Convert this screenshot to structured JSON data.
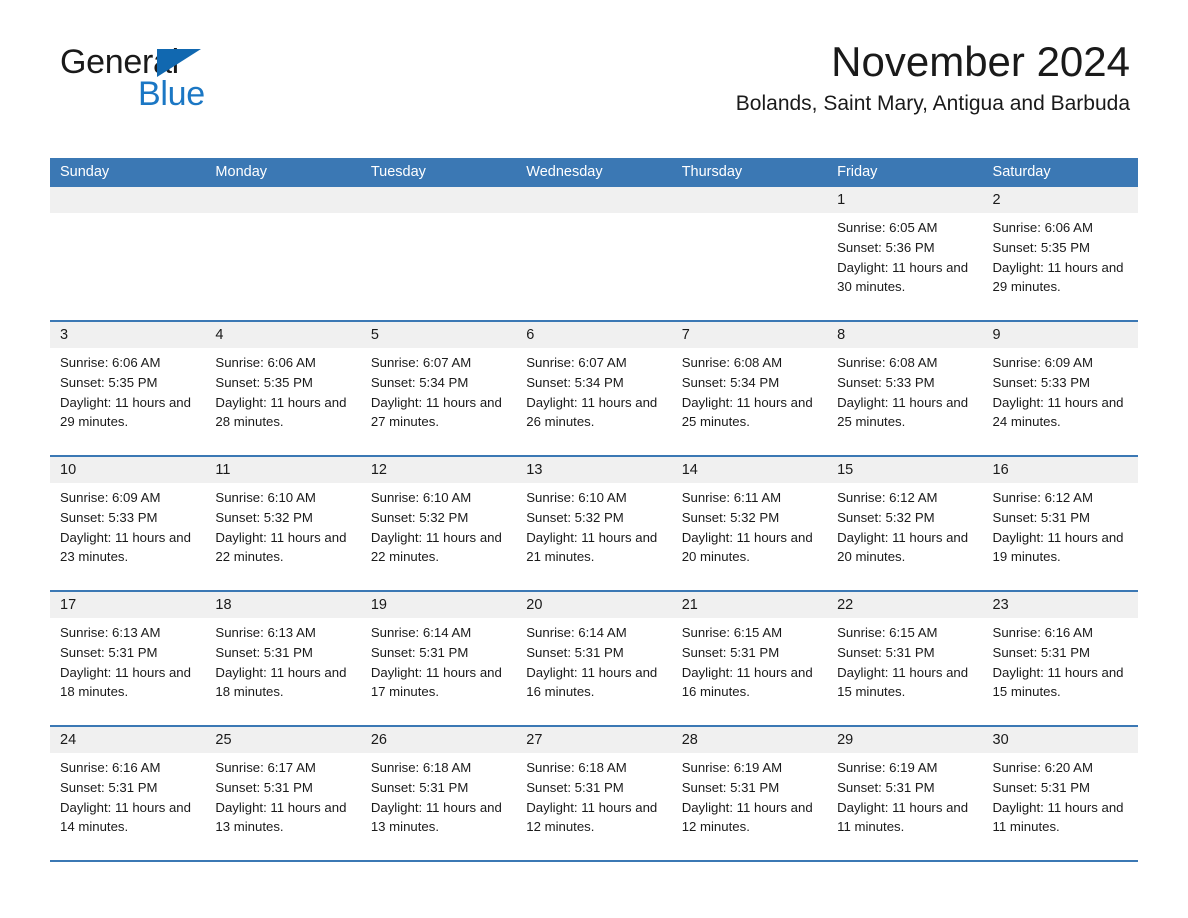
{
  "brand": {
    "name_part1": "General",
    "name_part2": "Blue",
    "logo_icon": "triangle-flag-icon",
    "accent_color": "#1b77c4"
  },
  "header": {
    "month_title": "November 2024",
    "location": "Bolands, Saint Mary, Antigua and Barbuda"
  },
  "calendar": {
    "header_bg": "#3b78b4",
    "daystrip_bg": "#f0f0f0",
    "weekday_headers": [
      "Sunday",
      "Monday",
      "Tuesday",
      "Wednesday",
      "Thursday",
      "Friday",
      "Saturday"
    ],
    "weeks": [
      [
        {
          "day": "",
          "sunrise": "",
          "sunset": "",
          "daylight": ""
        },
        {
          "day": "",
          "sunrise": "",
          "sunset": "",
          "daylight": ""
        },
        {
          "day": "",
          "sunrise": "",
          "sunset": "",
          "daylight": ""
        },
        {
          "day": "",
          "sunrise": "",
          "sunset": "",
          "daylight": ""
        },
        {
          "day": "",
          "sunrise": "",
          "sunset": "",
          "daylight": ""
        },
        {
          "day": "1",
          "sunrise": "Sunrise: 6:05 AM",
          "sunset": "Sunset: 5:36 PM",
          "daylight": "Daylight: 11 hours and 30 minutes."
        },
        {
          "day": "2",
          "sunrise": "Sunrise: 6:06 AM",
          "sunset": "Sunset: 5:35 PM",
          "daylight": "Daylight: 11 hours and 29 minutes."
        }
      ],
      [
        {
          "day": "3",
          "sunrise": "Sunrise: 6:06 AM",
          "sunset": "Sunset: 5:35 PM",
          "daylight": "Daylight: 11 hours and 29 minutes."
        },
        {
          "day": "4",
          "sunrise": "Sunrise: 6:06 AM",
          "sunset": "Sunset: 5:35 PM",
          "daylight": "Daylight: 11 hours and 28 minutes."
        },
        {
          "day": "5",
          "sunrise": "Sunrise: 6:07 AM",
          "sunset": "Sunset: 5:34 PM",
          "daylight": "Daylight: 11 hours and 27 minutes."
        },
        {
          "day": "6",
          "sunrise": "Sunrise: 6:07 AM",
          "sunset": "Sunset: 5:34 PM",
          "daylight": "Daylight: 11 hours and 26 minutes."
        },
        {
          "day": "7",
          "sunrise": "Sunrise: 6:08 AM",
          "sunset": "Sunset: 5:34 PM",
          "daylight": "Daylight: 11 hours and 25 minutes."
        },
        {
          "day": "8",
          "sunrise": "Sunrise: 6:08 AM",
          "sunset": "Sunset: 5:33 PM",
          "daylight": "Daylight: 11 hours and 25 minutes."
        },
        {
          "day": "9",
          "sunrise": "Sunrise: 6:09 AM",
          "sunset": "Sunset: 5:33 PM",
          "daylight": "Daylight: 11 hours and 24 minutes."
        }
      ],
      [
        {
          "day": "10",
          "sunrise": "Sunrise: 6:09 AM",
          "sunset": "Sunset: 5:33 PM",
          "daylight": "Daylight: 11 hours and 23 minutes."
        },
        {
          "day": "11",
          "sunrise": "Sunrise: 6:10 AM",
          "sunset": "Sunset: 5:32 PM",
          "daylight": "Daylight: 11 hours and 22 minutes."
        },
        {
          "day": "12",
          "sunrise": "Sunrise: 6:10 AM",
          "sunset": "Sunset: 5:32 PM",
          "daylight": "Daylight: 11 hours and 22 minutes."
        },
        {
          "day": "13",
          "sunrise": "Sunrise: 6:10 AM",
          "sunset": "Sunset: 5:32 PM",
          "daylight": "Daylight: 11 hours and 21 minutes."
        },
        {
          "day": "14",
          "sunrise": "Sunrise: 6:11 AM",
          "sunset": "Sunset: 5:32 PM",
          "daylight": "Daylight: 11 hours and 20 minutes."
        },
        {
          "day": "15",
          "sunrise": "Sunrise: 6:12 AM",
          "sunset": "Sunset: 5:32 PM",
          "daylight": "Daylight: 11 hours and 20 minutes."
        },
        {
          "day": "16",
          "sunrise": "Sunrise: 6:12 AM",
          "sunset": "Sunset: 5:31 PM",
          "daylight": "Daylight: 11 hours and 19 minutes."
        }
      ],
      [
        {
          "day": "17",
          "sunrise": "Sunrise: 6:13 AM",
          "sunset": "Sunset: 5:31 PM",
          "daylight": "Daylight: 11 hours and 18 minutes."
        },
        {
          "day": "18",
          "sunrise": "Sunrise: 6:13 AM",
          "sunset": "Sunset: 5:31 PM",
          "daylight": "Daylight: 11 hours and 18 minutes."
        },
        {
          "day": "19",
          "sunrise": "Sunrise: 6:14 AM",
          "sunset": "Sunset: 5:31 PM",
          "daylight": "Daylight: 11 hours and 17 minutes."
        },
        {
          "day": "20",
          "sunrise": "Sunrise: 6:14 AM",
          "sunset": "Sunset: 5:31 PM",
          "daylight": "Daylight: 11 hours and 16 minutes."
        },
        {
          "day": "21",
          "sunrise": "Sunrise: 6:15 AM",
          "sunset": "Sunset: 5:31 PM",
          "daylight": "Daylight: 11 hours and 16 minutes."
        },
        {
          "day": "22",
          "sunrise": "Sunrise: 6:15 AM",
          "sunset": "Sunset: 5:31 PM",
          "daylight": "Daylight: 11 hours and 15 minutes."
        },
        {
          "day": "23",
          "sunrise": "Sunrise: 6:16 AM",
          "sunset": "Sunset: 5:31 PM",
          "daylight": "Daylight: 11 hours and 15 minutes."
        }
      ],
      [
        {
          "day": "24",
          "sunrise": "Sunrise: 6:16 AM",
          "sunset": "Sunset: 5:31 PM",
          "daylight": "Daylight: 11 hours and 14 minutes."
        },
        {
          "day": "25",
          "sunrise": "Sunrise: 6:17 AM",
          "sunset": "Sunset: 5:31 PM",
          "daylight": "Daylight: 11 hours and 13 minutes."
        },
        {
          "day": "26",
          "sunrise": "Sunrise: 6:18 AM",
          "sunset": "Sunset: 5:31 PM",
          "daylight": "Daylight: 11 hours and 13 minutes."
        },
        {
          "day": "27",
          "sunrise": "Sunrise: 6:18 AM",
          "sunset": "Sunset: 5:31 PM",
          "daylight": "Daylight: 11 hours and 12 minutes."
        },
        {
          "day": "28",
          "sunrise": "Sunrise: 6:19 AM",
          "sunset": "Sunset: 5:31 PM",
          "daylight": "Daylight: 11 hours and 12 minutes."
        },
        {
          "day": "29",
          "sunrise": "Sunrise: 6:19 AM",
          "sunset": "Sunset: 5:31 PM",
          "daylight": "Daylight: 11 hours and 11 minutes."
        },
        {
          "day": "30",
          "sunrise": "Sunrise: 6:20 AM",
          "sunset": "Sunset: 5:31 PM",
          "daylight": "Daylight: 11 hours and 11 minutes."
        }
      ]
    ]
  }
}
